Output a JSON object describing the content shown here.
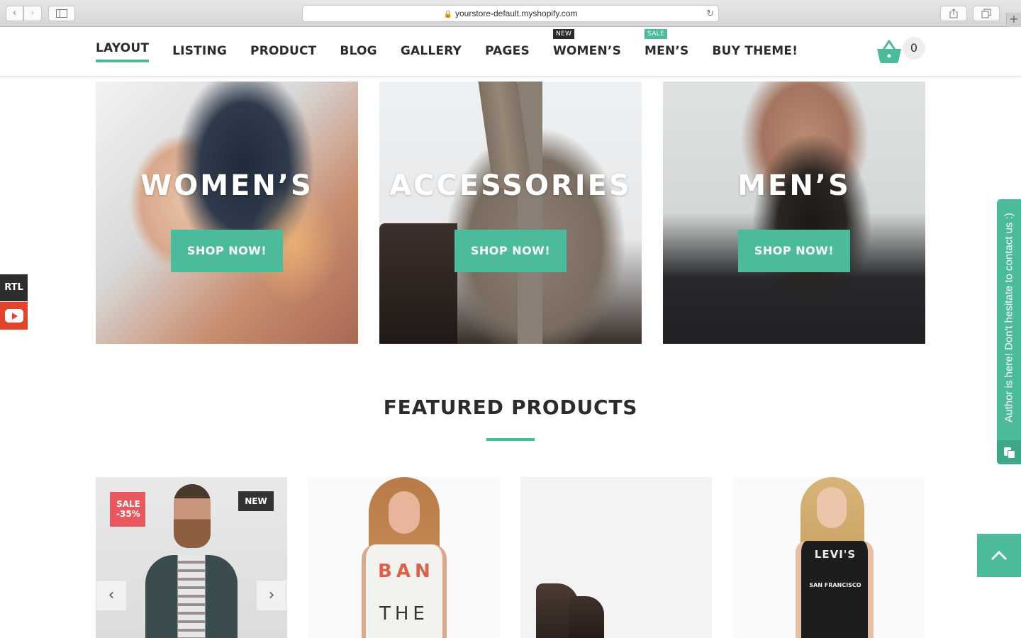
{
  "browser": {
    "url": "yourstore-default.myshopify.com",
    "back_label": "‹",
    "forward_label": "›",
    "reload_label": "↻",
    "new_tab_label": "+"
  },
  "nav": {
    "items": [
      {
        "label": "LAYOUT",
        "badge": ""
      },
      {
        "label": "LISTING",
        "badge": ""
      },
      {
        "label": "PRODUCT",
        "badge": ""
      },
      {
        "label": "BLOG",
        "badge": ""
      },
      {
        "label": "GALLERY",
        "badge": ""
      },
      {
        "label": "PAGES",
        "badge": ""
      },
      {
        "label": "WOMEN’S",
        "badge": "NEW"
      },
      {
        "label": "MEN’S",
        "badge": "SALE"
      },
      {
        "label": "BUY THEME!",
        "badge": ""
      }
    ],
    "cart_count": "0"
  },
  "banners": [
    {
      "title": "WOMEN’S",
      "button": "SHOP NOW!"
    },
    {
      "title": "ACCESSORIES",
      "button": "SHOP NOW!"
    },
    {
      "title": "MEN’S",
      "button": "SHOP NOW!"
    }
  ],
  "featured": {
    "title": "FEATURED PRODUCTS",
    "products": [
      {
        "sale_badge_line1": "SALE",
        "sale_badge_line2": "-35%",
        "new_badge": "NEW",
        "prev_arrow": "‹",
        "next_arrow": "›"
      },
      {
        "shirt_text_1": "BAN",
        "shirt_text_2": "THE"
      },
      {},
      {
        "shirt_logo": "LEVI'S",
        "shirt_logo_sub": "SAN FRANCISCO"
      }
    ]
  },
  "side": {
    "rtl_label": "RTL",
    "contact_label": "Author is here! Don't hesitate to contact us :)"
  },
  "colors": {
    "accent": "#4cbb9b",
    "sale_badge": "#e8585f",
    "new_badge": "#333333",
    "youtube": "#e0452b"
  },
  "icons": {
    "cart": "basket-icon",
    "to_top": "chevron-up-icon",
    "youtube": "youtube-icon",
    "contact": "chat-icon"
  }
}
